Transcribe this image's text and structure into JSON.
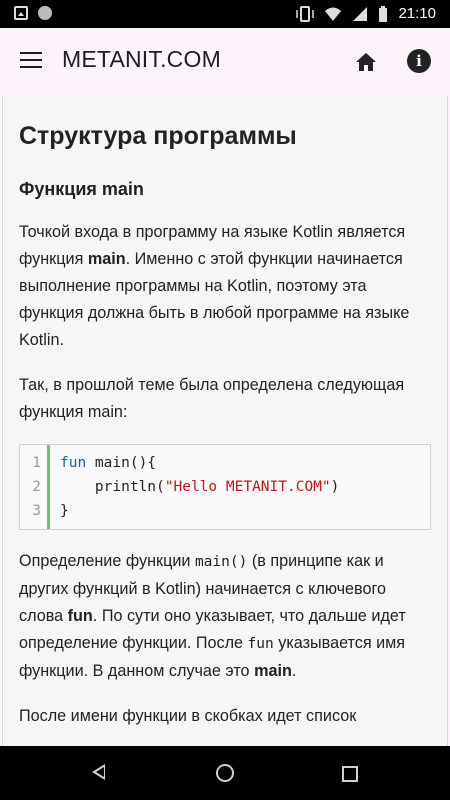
{
  "status_bar": {
    "time": "21:10"
  },
  "app_bar": {
    "title": "METANIT.COM"
  },
  "article": {
    "heading": "Структура программы",
    "subheading": "Функция main",
    "p1": {
      "before": "Точкой входа в программу на языке Kotlin является функция ",
      "bold": "main",
      "after": ". Именно с этой функции начинается выполнение программы на Kotlin, поэтому эта функция должна быть в любой программе на языке Kotlin."
    },
    "p2": "Так, в прошлой теме была определена следующая функция main:",
    "code": {
      "line_numbers": [
        "1",
        "2",
        "3"
      ],
      "line1": {
        "keyword": "fun",
        "rest": " main(){"
      },
      "line2": {
        "before": "    println(",
        "string": "\"Hello METANIT.COM\"",
        "after": ")"
      },
      "line3": "}"
    },
    "p3": {
      "t1": "Определение функции ",
      "code1": "main()",
      "t2": " (в принципе как и других функций в Kotlin) начинается с ключевого слова ",
      "bold1": "fun",
      "t3": ". По сути оно указывает, что дальше идет определение функции. После ",
      "code2": "fun",
      "t4": " указывается имя функции. В данном случае это ",
      "bold2": "main",
      "t5": "."
    },
    "p4": "После имени функции в скобках идет список"
  },
  "colors": {
    "appbar_bg": "#fcf3fb",
    "code_gutter_accent": "#6ac66b",
    "keyword": "#1f5fa8",
    "string": "#c2181b"
  }
}
